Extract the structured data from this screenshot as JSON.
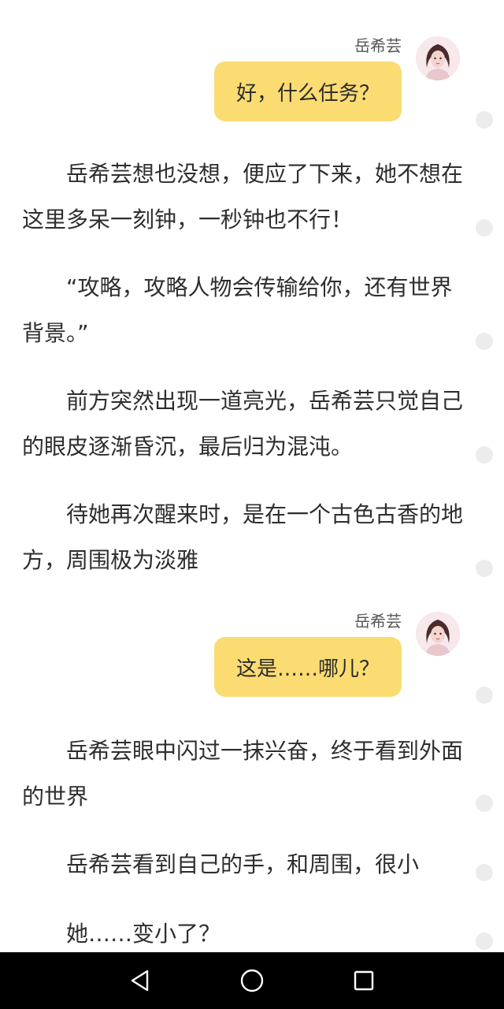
{
  "messages": [
    {
      "speaker": "岳希芸",
      "text": "好，什么任务？",
      "avatar": "female-portrait-avatar"
    },
    {
      "speaker": "岳希芸",
      "text": "这是……哪儿？",
      "avatar": "female-portrait-avatar"
    }
  ],
  "paragraphs": [
    "岳希芸想也没想，便应了下来，她不想在这里多呆一刻钟，一秒钟也不行！",
    "“攻略，攻略人物会传输给你，还有世界背景。”",
    "前方突然出现一道亮光，岳希芸只觉自己的眼皮逐渐昏沉，最后归为混沌。",
    "待她再次醒来时，是在一个古色古香的地方，周围极为淡雅",
    "岳希芸眼中闪过一抹兴奋，终于看到外面的世界",
    "岳希芸看到自己的手，和周围，很小",
    "她……变小了？"
  ],
  "colors": {
    "bubble": "#fbdc73",
    "text": "#2e2e2e",
    "navbar": "#000000",
    "dot": "#ececec"
  },
  "navbar": {
    "icons": [
      "back-triangle-icon",
      "home-circle-icon",
      "recents-square-icon"
    ]
  }
}
